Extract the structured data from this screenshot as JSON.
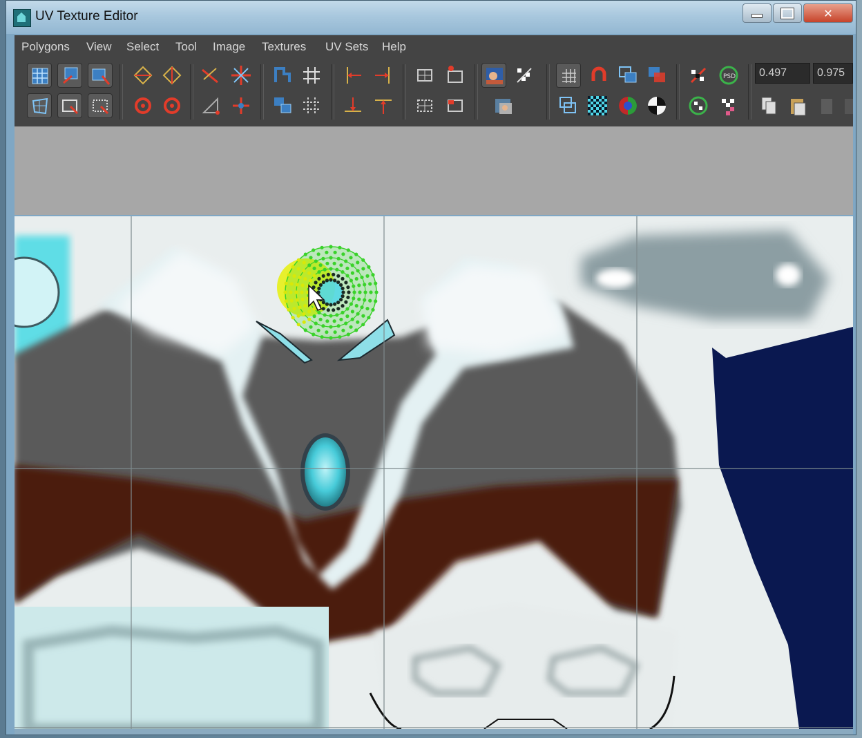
{
  "window": {
    "title": "UV Texture Editor",
    "controls": {
      "minimize": "minimize",
      "maximize": "maximize",
      "close": "✕"
    }
  },
  "menubar": {
    "items": [
      "Polygons",
      "View",
      "Select",
      "Tool",
      "Image",
      "Textures",
      "UV Sets",
      "Help"
    ]
  },
  "toolbar": {
    "groups": [
      {
        "name": "selection-tools",
        "icons": [
          "uv-lattice-icon",
          "move-uv-shell-icon",
          "smudge-uv-icon",
          "select-uv-frame-icon",
          "select-uv-face-icon",
          "select-uv-shell-icon"
        ]
      },
      {
        "name": "flip-rotate",
        "icons": [
          "flip-u-icon",
          "flip-v-icon",
          "rotate-ccw-icon",
          "rotate-cw-icon"
        ]
      },
      {
        "name": "cut-sew",
        "icons": [
          "cut-uv-edges-icon",
          "split-uvs-icon",
          "unitize-icon",
          "sew-uv-edges-icon"
        ]
      },
      {
        "name": "layout",
        "icons": [
          "layout-uvs-icon",
          "grid-uvs-icon",
          "move-sew-icon",
          "unfold-icon"
        ]
      },
      {
        "name": "align",
        "icons": [
          "align-min-u-icon",
          "align-max-u-icon",
          "align-min-v-icon",
          "align-max-v-icon"
        ]
      },
      {
        "name": "iso",
        "icons": [
          "iso-select-icon",
          "iso-add-icon",
          "iso-remove-icon",
          "iso-clear-icon"
        ]
      },
      {
        "name": "image",
        "icons": [
          "display-image-icon",
          "checker-dim-icon",
          "image-ratio-icon"
        ]
      },
      {
        "name": "grid-snap",
        "icons": [
          "toggle-grid-icon",
          "snap-pixels-icon",
          "shade-uv-icon",
          "overlap-uv-icon",
          "display-uv-border-icon",
          "checker-map-icon",
          "rgb-channels-icon",
          "alpha-channel-icon"
        ]
      },
      {
        "name": "psd",
        "icons": [
          "update-psd-icon",
          "psd-network-icon",
          "uv-snapshot-icon",
          "checker-swap-icon"
        ]
      }
    ],
    "coords": {
      "u": "0.497",
      "v": "0.975"
    },
    "clipboard_icons": [
      "copy-uvs-icon",
      "paste-uvs-icon",
      "paste-u-icon",
      "paste-v-icon"
    ]
  },
  "viewport": {
    "grid": {
      "shown": true
    },
    "colors": {
      "background": "#e9eeee",
      "armor_gray": "#5b5b5b",
      "armor_dark_red": "#4a1a12",
      "highlight": "#e6f3f5",
      "cyan_gem": "#54d8e6",
      "navy_shell": "#0a1850",
      "uv_points": "#3ad22a",
      "soft_select": "#e8f20a"
    },
    "cursor": "arrow-pointer-icon"
  }
}
